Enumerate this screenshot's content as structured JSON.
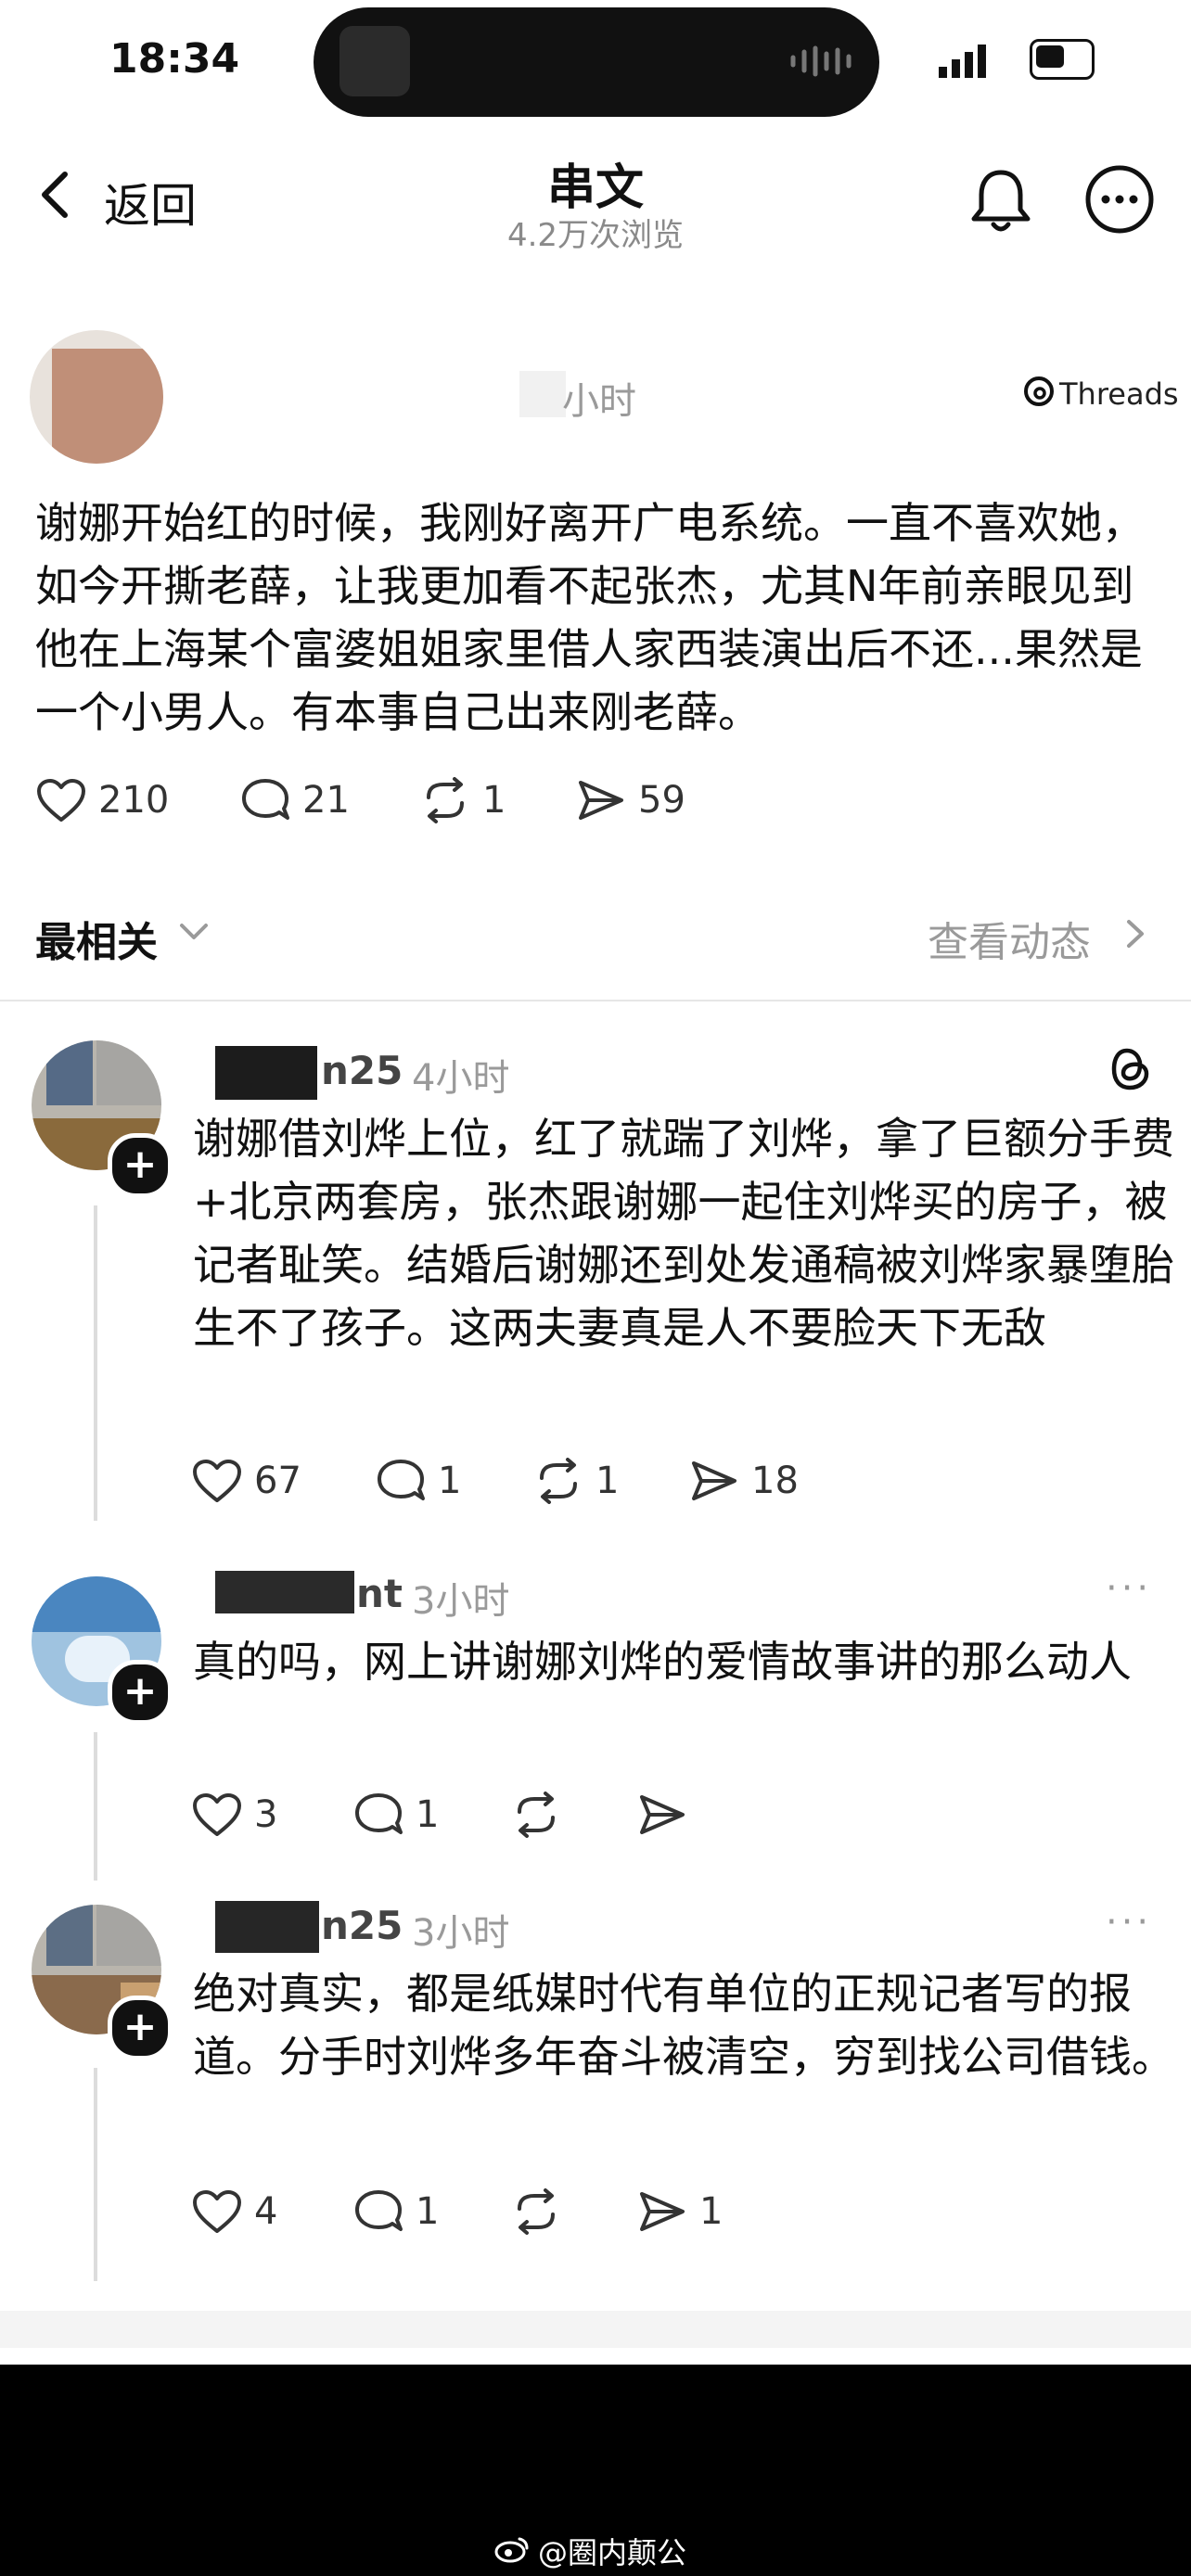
{
  "status": {
    "time": "18:34",
    "right": "4G",
    "battery": "56"
  },
  "nav": {
    "back_label": "返回",
    "title": "串文",
    "subtitle": "4.2万次浏览"
  },
  "post": {
    "time": "小时",
    "threads_label": "Threads",
    "text": "谢娜开始红的时候，我刚好离开广电系统。一直不喜欢她，如今开撕老薛，让我更加看不起张杰，尤其N年前亲眼见到他在上海某个富婆姐姐家里借人家西装演出后不还...果然是一个小男人。有本事自己出来刚老薛。",
    "likes": "210",
    "replies": "21",
    "reposts": "1",
    "shares": "59"
  },
  "sort": {
    "label": "最相关",
    "activity": "查看动态"
  },
  "comments": [
    {
      "name": "n25",
      "time": "4小时",
      "text": "谢娜借刘烨上位，红了就踹了刘烨，拿了巨额分手费+北京两套房，张杰跟谢娜一起住刘烨买的房子，被记者耻笑。结婚后谢娜还到处发通稿被刘烨家暴堕胎生不了孩子。这两夫妻真是人不要脸天下无敌",
      "likes": "67",
      "replies": "1",
      "reposts": "1",
      "shares": "18"
    },
    {
      "name": "nt",
      "time": "3小时",
      "text": "真的吗，网上讲谢娜刘烨的爱情故事讲的那么动人",
      "likes": "3",
      "replies": "1",
      "reposts": "",
      "shares": ""
    },
    {
      "name": "n25",
      "time": "3小时",
      "text": "绝对真实，都是纸媒时代有单位的正规记者写的报道。分手时刘烨多年奋斗被清空，穷到找公司借钱。",
      "likes": "4",
      "replies": "1",
      "reposts": "",
      "shares": "1"
    }
  ],
  "watermark": "@圈内颠公",
  "colors": {
    "text": "#111111",
    "muted": "#9a9a9a",
    "background": "#ffffff"
  }
}
